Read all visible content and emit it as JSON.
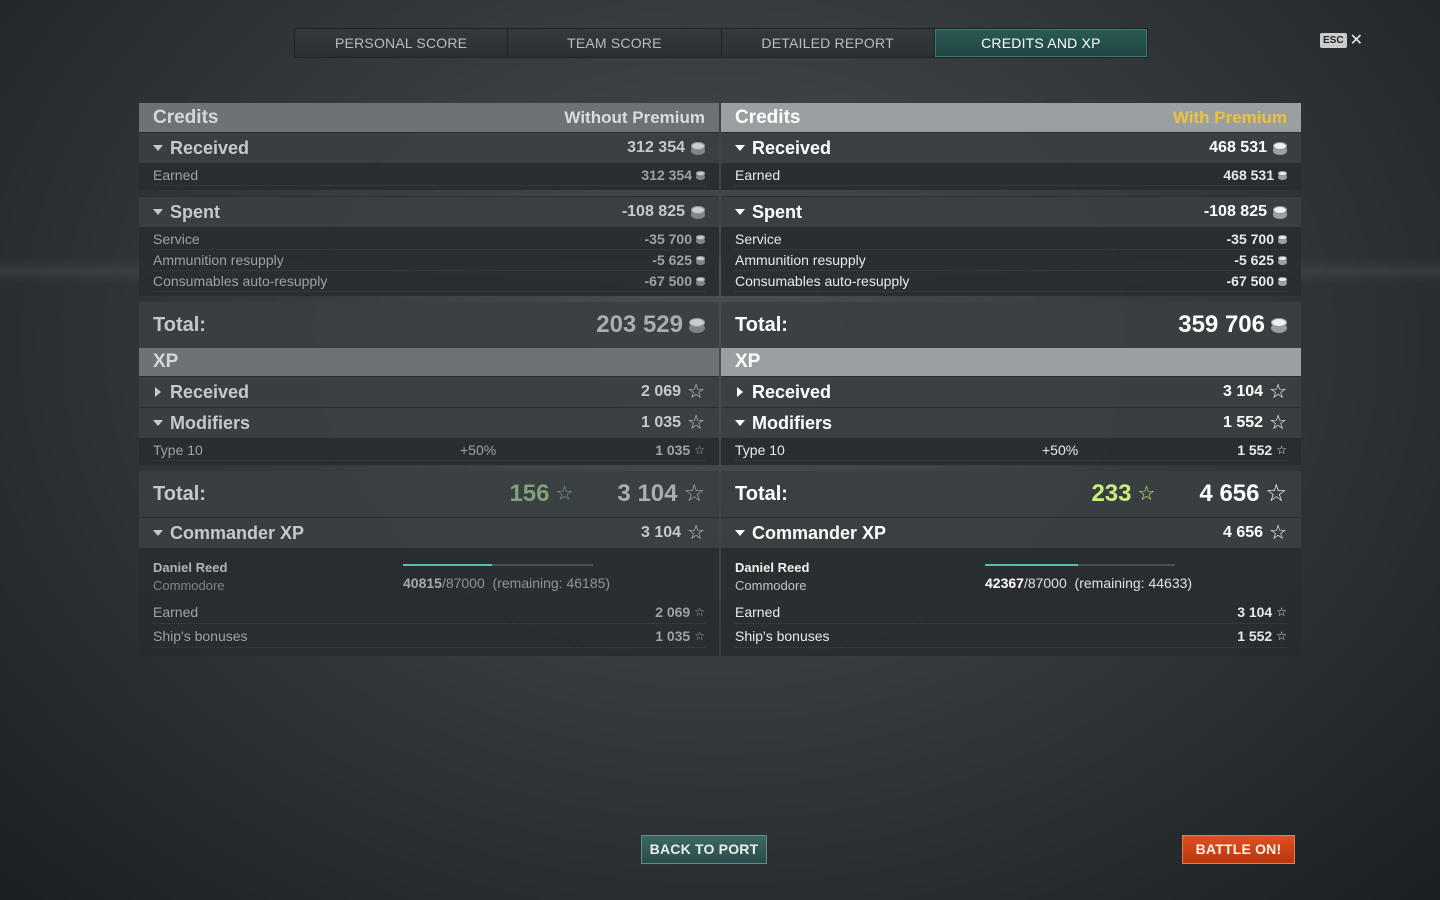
{
  "tabs": [
    "PERSONAL SCORE",
    "TEAM SCORE",
    "DETAILED REPORT",
    "CREDITS AND XP"
  ],
  "active_tab": "CREDITS AND XP",
  "esc": {
    "key": "ESC",
    "close": "✕"
  },
  "colors": {
    "accent": "#2b5a55",
    "premium": "#f0c23a",
    "battle_button": "#d4471a",
    "xp_bonus_premium": "#c9ef7a",
    "xp_bonus_standard": "#7fa27a"
  },
  "icons": {
    "credits": "credits-coin-icon",
    "xp": "xp-star-icon",
    "expand": "triangle-down-icon",
    "collapsed": "triangle-right-icon"
  },
  "left": {
    "credits_title": "Credits",
    "mode": "Without Premium",
    "received": {
      "label": "Received",
      "value": "312 354"
    },
    "received_rows": [
      {
        "label": "Earned",
        "value": "312 354"
      }
    ],
    "spent": {
      "label": "Spent",
      "value": "-108 825"
    },
    "spent_rows": [
      {
        "label": "Service",
        "value": "-35 700"
      },
      {
        "label": "Ammunition resupply",
        "value": "-5 625"
      },
      {
        "label": "Consumables auto-resupply",
        "value": "-67 500"
      }
    ],
    "credits_total": {
      "label": "Total:",
      "value": "203 529"
    },
    "xp_title": "XP",
    "xp_received": {
      "label": "Received",
      "value": "2 069"
    },
    "modifiers": {
      "label": "Modifiers",
      "value": "1 035"
    },
    "modifier_rows": [
      {
        "label": "Type 10",
        "percent": "+50%",
        "value": "1 035"
      }
    ],
    "xp_total": {
      "label": "Total:",
      "bonus": "156",
      "value": "3 104"
    },
    "commander": {
      "label": "Commander XP",
      "value": "3 104",
      "name": "Daniel Reed",
      "rank": "Commodore",
      "progress_current": "40815",
      "progress_max": "/87000",
      "remaining": "(remaining: 46185)",
      "progress_fraction": 0.469,
      "rows": [
        {
          "label": "Earned",
          "value": "2 069"
        },
        {
          "label": "Ship's bonuses",
          "value": "1 035"
        }
      ]
    }
  },
  "right": {
    "credits_title": "Credits",
    "mode": "With Premium",
    "received": {
      "label": "Received",
      "value": "468 531"
    },
    "received_rows": [
      {
        "label": "Earned",
        "value": "468 531"
      }
    ],
    "spent": {
      "label": "Spent",
      "value": "-108 825"
    },
    "spent_rows": [
      {
        "label": "Service",
        "value": "-35 700"
      },
      {
        "label": "Ammunition resupply",
        "value": "-5 625"
      },
      {
        "label": "Consumables auto-resupply",
        "value": "-67 500"
      }
    ],
    "credits_total": {
      "label": "Total:",
      "value": "359 706"
    },
    "xp_title": "XP",
    "xp_received": {
      "label": "Received",
      "value": "3 104"
    },
    "modifiers": {
      "label": "Modifiers",
      "value": "1 552"
    },
    "modifier_rows": [
      {
        "label": "Type 10",
        "percent": "+50%",
        "value": "1 552"
      }
    ],
    "xp_total": {
      "label": "Total:",
      "bonus": "233",
      "value": "4 656"
    },
    "commander": {
      "label": "Commander XP",
      "value": "4 656",
      "name": "Daniel Reed",
      "rank": "Commodore",
      "progress_current": "42367",
      "progress_max": "/87000",
      "remaining": "(remaining: 44633)",
      "progress_fraction": 0.487,
      "rows": [
        {
          "label": "Earned",
          "value": "3 104"
        },
        {
          "label": "Ship's bonuses",
          "value": "1 552"
        }
      ]
    }
  },
  "buttons": {
    "back": "BACK TO PORT",
    "battle": "BATTLE ON!"
  }
}
